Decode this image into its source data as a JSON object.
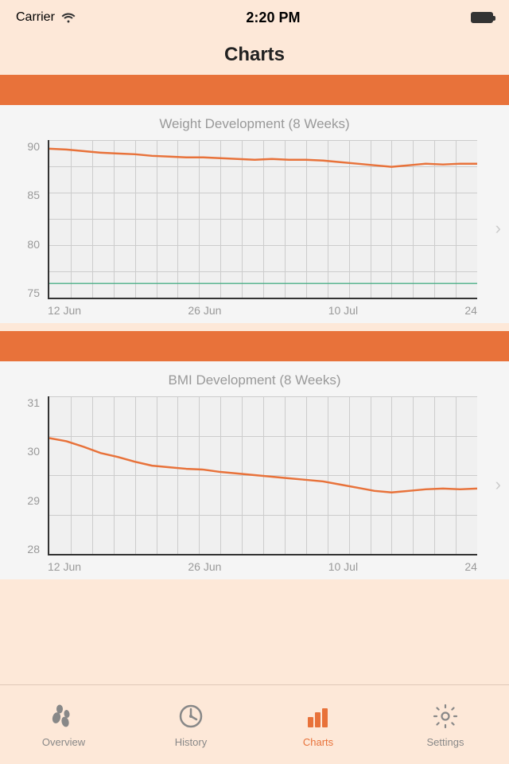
{
  "statusBar": {
    "carrier": "Carrier",
    "time": "2:20 PM"
  },
  "header": {
    "title": "Charts"
  },
  "weightChart": {
    "title": "Weight Development (8 Weeks)",
    "yLabels": [
      "90",
      "85",
      "80",
      "75"
    ],
    "xLabels": [
      "12 Jun",
      "26 Jun",
      "10 Jul",
      "24"
    ],
    "yMin": 74,
    "yMax": 92,
    "goalLine": 75.5
  },
  "bmiChart": {
    "title": "BMI Development (8 Weeks)",
    "yLabels": [
      "31",
      "30",
      "29",
      "28"
    ],
    "xLabels": [
      "12 Jun",
      "26 Jun",
      "10 Jul",
      "24"
    ],
    "yMin": 27.5,
    "yMax": 32
  },
  "bottomNav": {
    "items": [
      {
        "id": "overview",
        "label": "Overview",
        "icon": "footprint",
        "active": false
      },
      {
        "id": "history",
        "label": "History",
        "icon": "clock",
        "active": false
      },
      {
        "id": "charts",
        "label": "Charts",
        "icon": "bar-chart",
        "active": true
      },
      {
        "id": "settings",
        "label": "Settings",
        "icon": "gear",
        "active": false
      }
    ]
  }
}
